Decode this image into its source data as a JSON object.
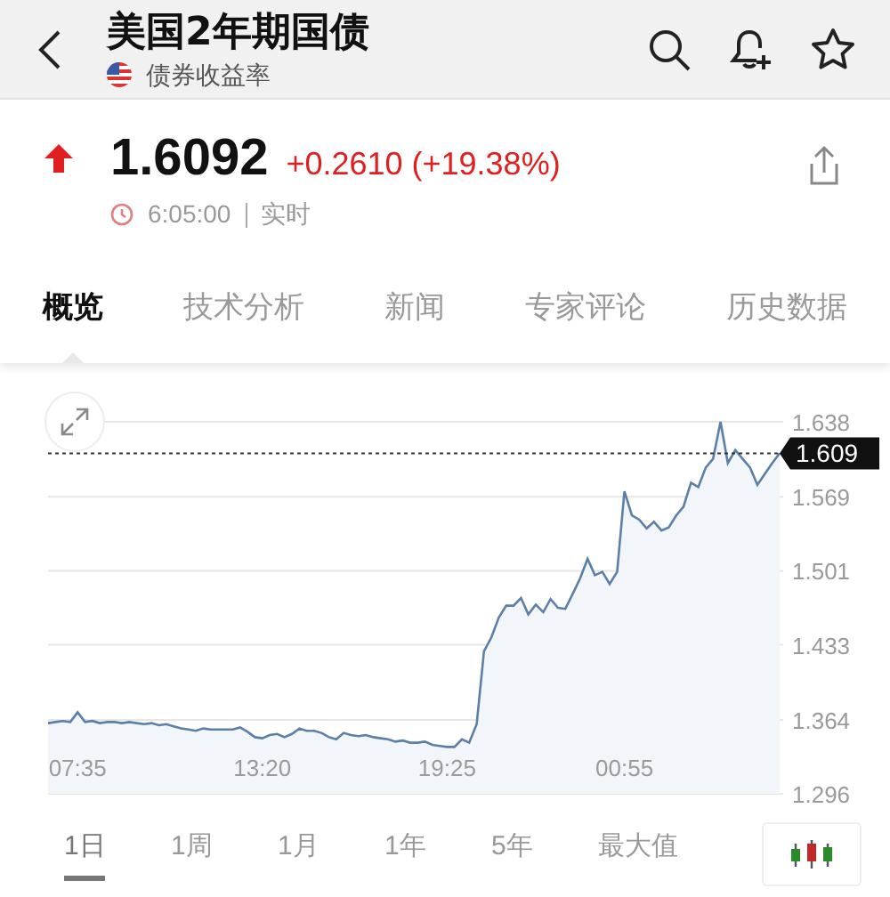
{
  "header": {
    "title": "美国2年期国债",
    "subtitle": "债券收益率"
  },
  "quote": {
    "up": true,
    "price": "1.6092",
    "change": "+0.2610 (+19.38%)",
    "time": "6:05:00",
    "status": "实时"
  },
  "tabs": [
    {
      "label": "概览",
      "selected": true
    },
    {
      "label": "技术分析",
      "selected": false
    },
    {
      "label": "新闻",
      "selected": false
    },
    {
      "label": "专家评论",
      "selected": false
    },
    {
      "label": "历史数据",
      "selected": false
    }
  ],
  "chart": {
    "chart_data": {
      "type": "area",
      "grid": true,
      "ref_lines": [
        {
          "axis": "y",
          "value": 1.609,
          "label": "1.609"
        }
      ],
      "categories": [
        null,
        null,
        null,
        null,
        "07:35",
        null,
        null,
        null,
        null,
        null,
        null,
        null,
        null,
        null,
        null,
        null,
        null,
        null,
        null,
        null,
        null,
        null,
        null,
        null,
        null,
        null,
        null,
        null,
        null,
        "13:20",
        null,
        null,
        null,
        null,
        null,
        null,
        null,
        null,
        null,
        null,
        null,
        null,
        null,
        null,
        null,
        null,
        null,
        null,
        null,
        null,
        null,
        null,
        null,
        null,
        "19:25",
        null,
        null,
        null,
        null,
        null,
        null,
        null,
        null,
        null,
        null,
        null,
        null,
        null,
        null,
        null,
        null,
        null,
        null,
        null,
        null,
        null,
        null,
        null,
        "00:55",
        null,
        null,
        null,
        null,
        null,
        null,
        null,
        null,
        null,
        null,
        null,
        null,
        null,
        null,
        null,
        null,
        null,
        null,
        null,
        null,
        null
      ],
      "ylim": [
        1.296,
        1.638
      ],
      "yticks": [
        1.638,
        1.569,
        1.501,
        1.433,
        1.364,
        1.296
      ],
      "series": [
        {
          "color": "#5b7fa6",
          "values": [
            1.361,
            1.362,
            1.363,
            1.362,
            1.371,
            1.362,
            1.363,
            1.361,
            1.362,
            1.362,
            1.361,
            1.362,
            1.361,
            1.36,
            1.361,
            1.359,
            1.36,
            1.358,
            1.356,
            1.355,
            1.354,
            1.356,
            1.355,
            1.355,
            1.355,
            1.355,
            1.357,
            1.353,
            1.348,
            1.347,
            1.35,
            1.351,
            1.348,
            1.351,
            1.356,
            1.354,
            1.354,
            1.352,
            1.348,
            1.346,
            1.352,
            1.35,
            1.349,
            1.35,
            1.348,
            1.347,
            1.346,
            1.344,
            1.345,
            1.343,
            1.343,
            1.344,
            1.341,
            1.34,
            1.339,
            1.339,
            1.346,
            1.343,
            1.36,
            1.427,
            1.44,
            1.458,
            1.469,
            1.469,
            1.476,
            1.461,
            1.47,
            1.463,
            1.475,
            1.467,
            1.466,
            1.48,
            1.494,
            1.512,
            1.497,
            1.5,
            1.489,
            1.5,
            1.574,
            1.552,
            1.548,
            1.54,
            1.546,
            1.538,
            1.541,
            1.552,
            1.56,
            1.582,
            1.578,
            1.596,
            1.604,
            1.638,
            1.6,
            1.612,
            1.604,
            1.596,
            1.58,
            1.59,
            1.6,
            1.609
          ]
        }
      ]
    }
  },
  "ranges": [
    {
      "label": "1日",
      "selected": true
    },
    {
      "label": "1周",
      "selected": false
    },
    {
      "label": "1月",
      "selected": false
    },
    {
      "label": "1年",
      "selected": false
    },
    {
      "label": "5年",
      "selected": false
    },
    {
      "label": "最大值",
      "selected": false
    }
  ]
}
